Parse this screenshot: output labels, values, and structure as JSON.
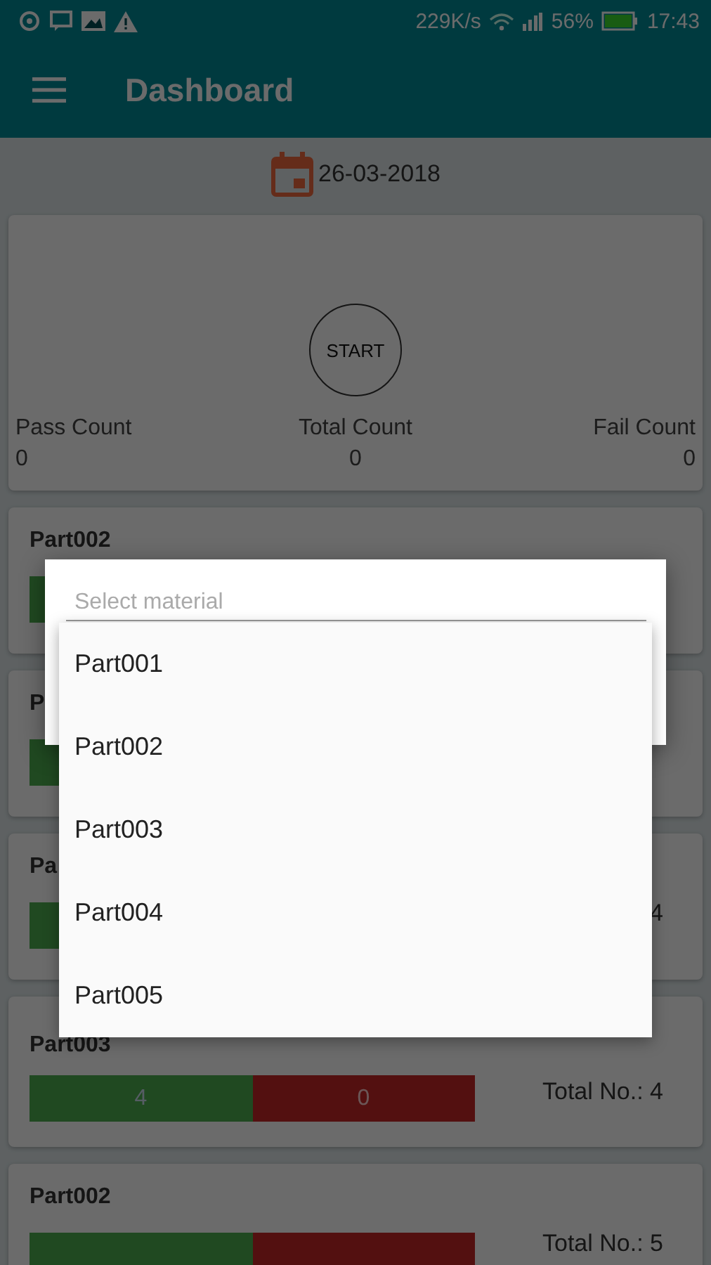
{
  "status_bar": {
    "speed": "229K/s",
    "battery": "56%",
    "time": "17:43"
  },
  "app_bar": {
    "title": "Dashboard"
  },
  "date": "26-03-2018",
  "summary": {
    "button": "START",
    "stats": [
      {
        "label": "Pass Count",
        "value": "0"
      },
      {
        "label": "Total Count",
        "value": "0"
      },
      {
        "label": "Fail Count",
        "value": "0"
      }
    ]
  },
  "parts": [
    {
      "kind": "covered",
      "name": "Part002"
    },
    {
      "kind": "covered",
      "name": "P"
    },
    {
      "kind": "covered",
      "name": "Pa",
      "total": "4"
    },
    {
      "kind": "full",
      "name": "Part003",
      "total": "Total No.: 4",
      "pass": "4",
      "fail": "0"
    },
    {
      "kind": "full",
      "name": "Part002",
      "total": "Total No.: 5"
    }
  ],
  "dialog": {
    "placeholder": "Select material",
    "options": [
      {
        "label": "Part001",
        "selected": false
      },
      {
        "label": "Part002",
        "selected": false
      },
      {
        "label": "Part003",
        "selected": false
      },
      {
        "label": "Part004",
        "selected": false
      },
      {
        "label": "Part005",
        "selected": false
      }
    ]
  }
}
